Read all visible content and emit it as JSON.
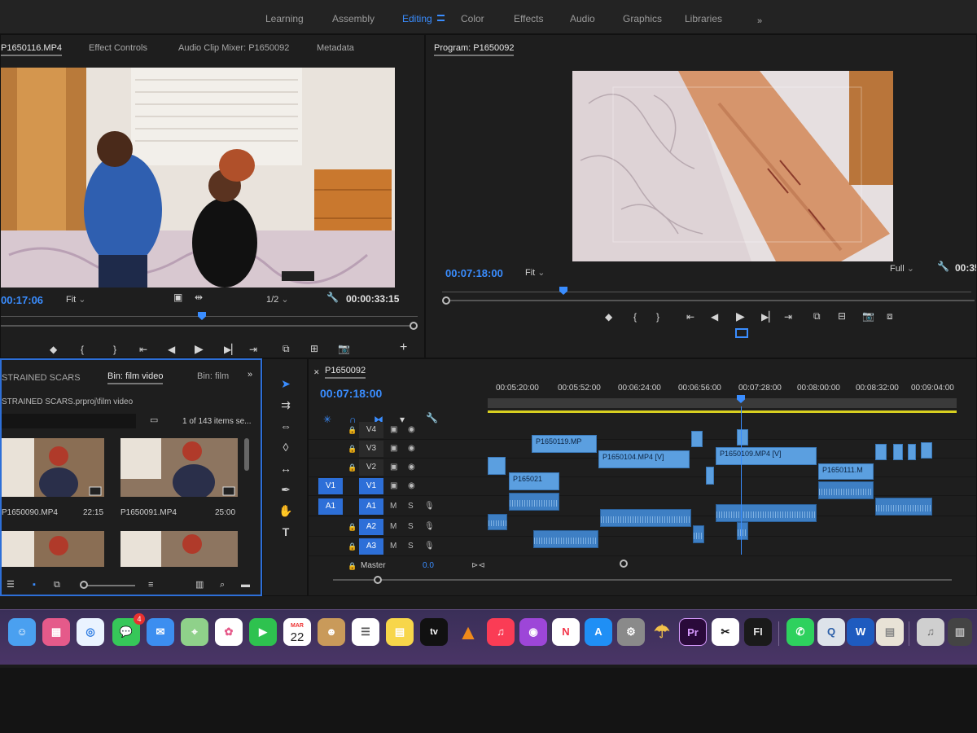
{
  "workspace": {
    "tabs": [
      "Learning",
      "Assembly",
      "Editing",
      "Color",
      "Effects",
      "Audio",
      "Graphics",
      "Libraries"
    ],
    "active": "Editing",
    "more": "»"
  },
  "source": {
    "tabs": [
      "P1650116.MP4",
      "Effect Controls",
      "Audio Clip Mixer: P1650092",
      "Metadata"
    ],
    "timecode_left": "00:17:06",
    "fit": "Fit",
    "resolution": "1/2",
    "duration": "00:00:33:15"
  },
  "program": {
    "title": "Program: P1650092",
    "timecode": "00:07:18:00",
    "fit": "Fit",
    "quality": "Full",
    "timecode_right": "00:35"
  },
  "project": {
    "tabs": [
      "STRAINED SCARS",
      "Bin: film video",
      "Bin: film"
    ],
    "path": "STRAINED SCARS.prproj\\film video",
    "count": "1 of 143 items se...",
    "items": [
      {
        "name": "P1650090.MP4",
        "duration": "22:15"
      },
      {
        "name": "P1650091.MP4",
        "duration": "25:00"
      }
    ]
  },
  "timeline": {
    "sequence": "P1650092",
    "timecode": "00:07:18:00",
    "ruler": [
      "00:05:20:00",
      "00:05:52:00",
      "00:06:24:00",
      "00:06:56:00",
      "00:07:28:00",
      "00:08:00:00",
      "00:08:32:00",
      "00:09:04:00"
    ],
    "video_tracks": [
      "V4",
      "V3",
      "V2",
      "V1"
    ],
    "audio_tracks": [
      "A1",
      "A2",
      "A3"
    ],
    "source_patch_v": "V1",
    "source_patch_a": "A1",
    "master_label": "Master",
    "master_value": "0.0",
    "mute": "M",
    "solo": "S",
    "clips": [
      "P1650119.MP",
      "P1650104.MP4 [V]",
      "P1650109.MP4 [V]",
      "P165021",
      "P1650111.M"
    ]
  },
  "dock": {
    "messages_badge": "4",
    "calendar_month": "MAR",
    "calendar_day": "22",
    "premiere_label": "Pr",
    "final_label": "FI",
    "tv_label": "tv"
  }
}
